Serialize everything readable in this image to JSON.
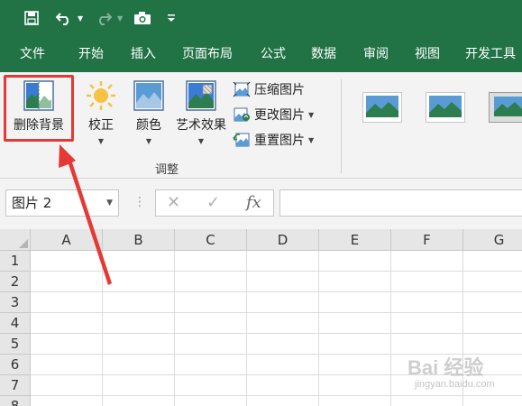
{
  "qat": {
    "icons": [
      "save-icon",
      "undo-icon",
      "redo-icon",
      "camera-icon",
      "customize-icon"
    ]
  },
  "tabs": [
    "文件",
    "开始",
    "插入",
    "页面布局",
    "公式",
    "数据",
    "审阅",
    "视图",
    "开发工具"
  ],
  "ribbon": {
    "remove_bg": "删除背景",
    "corrections": "校正",
    "color": "颜色",
    "artistic": "艺术效果",
    "compress": "压缩图片",
    "change": "更改图片",
    "reset": "重置图片",
    "group_label": "调整"
  },
  "formula_bar": {
    "name_box": "图片 2",
    "fx": "fx"
  },
  "grid": {
    "columns": [
      "A",
      "B",
      "C",
      "D",
      "E",
      "F",
      "G"
    ],
    "rows": [
      "1",
      "2",
      "3",
      "4",
      "5",
      "6",
      "7",
      "8"
    ]
  },
  "annotation": {
    "color": "#e53935"
  },
  "watermark": {
    "text": "Bai 经验",
    "sub": "jingyan.baidu.com"
  },
  "colors": {
    "accent": "#217346",
    "ribbon_bg": "#f3f3f3"
  }
}
